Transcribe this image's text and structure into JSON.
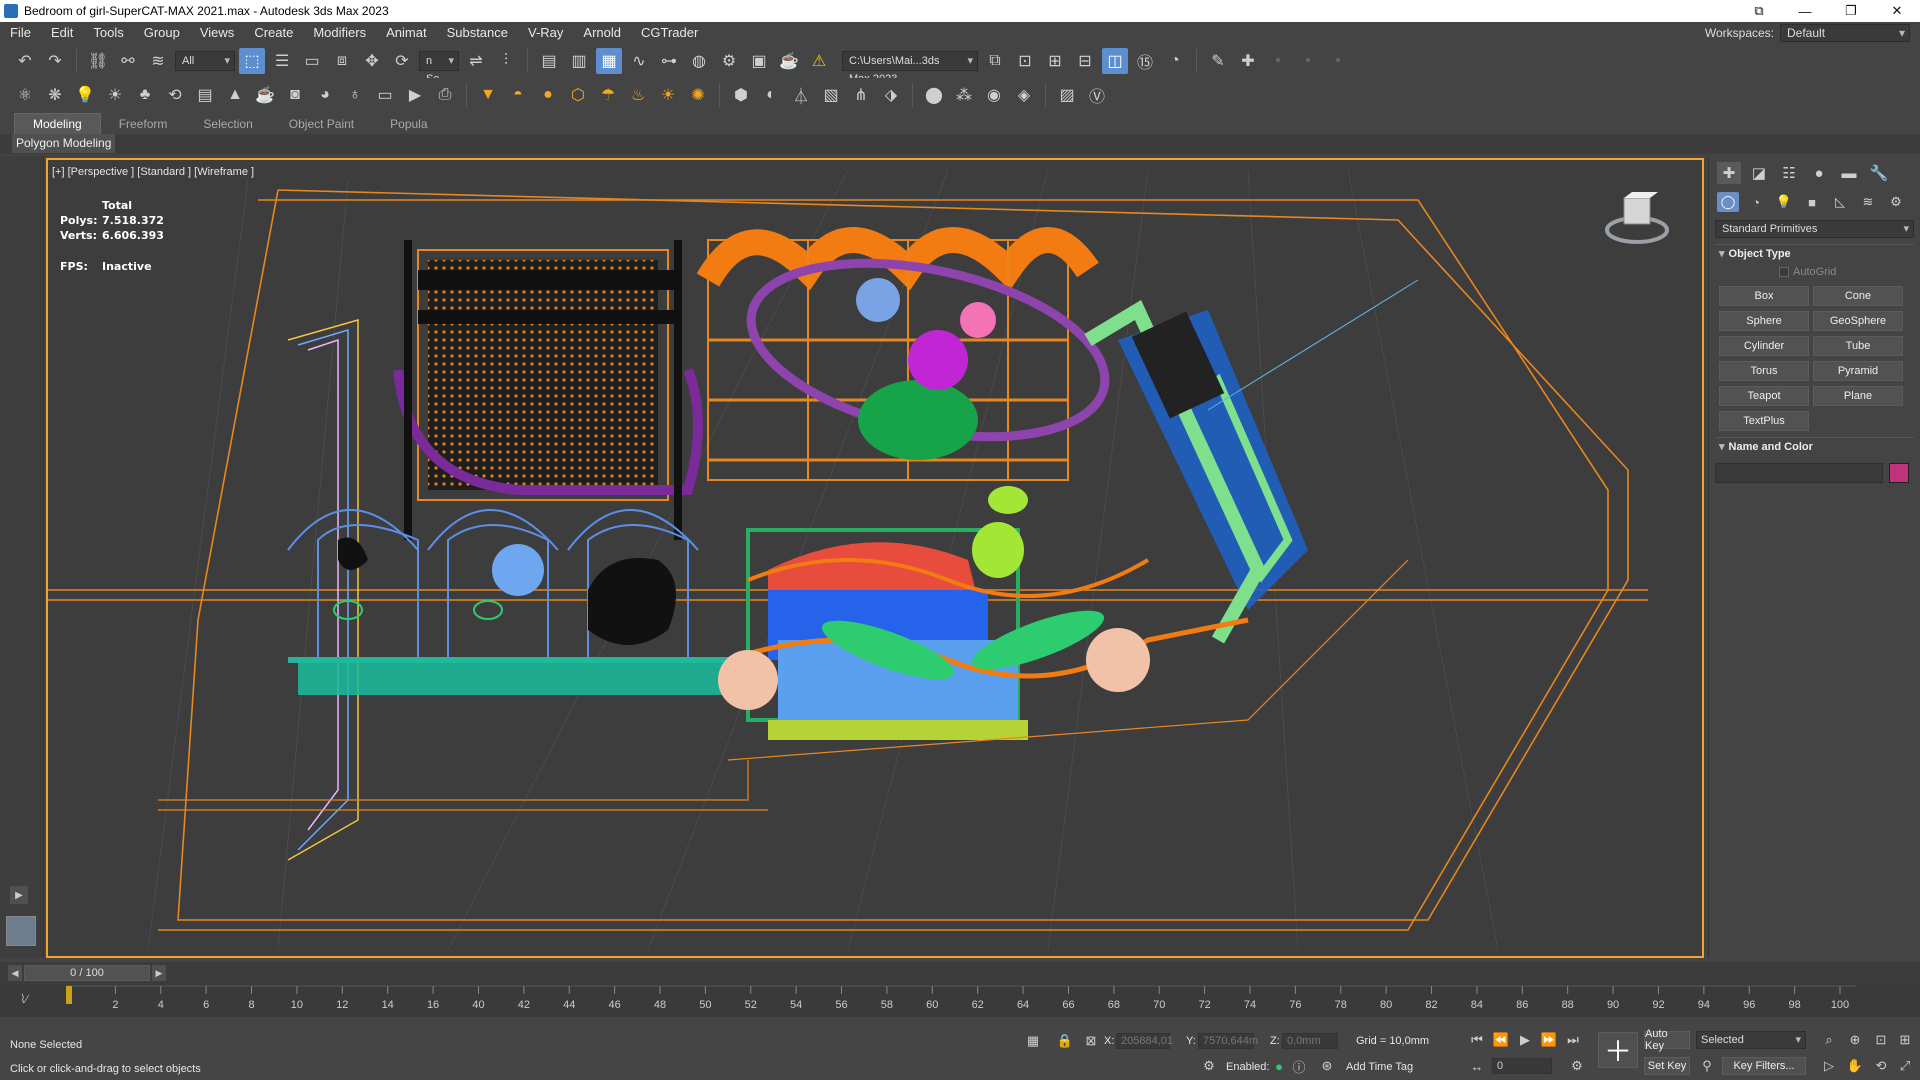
{
  "window": {
    "title": "Bedroom of girl-SuperCAT-MAX 2021.max - Autodesk 3ds Max 2023",
    "controls": [
      "⧉",
      "—",
      "❐",
      "✕"
    ]
  },
  "menu": {
    "items": [
      "File",
      "Edit",
      "Tools",
      "Group",
      "Views",
      "Create",
      "Modifiers",
      "Animat",
      "Substance",
      "V-Ray",
      "Arnold",
      "CGTrader"
    ],
    "workspaces_label": "Workspaces:",
    "workspaces_value": "Default"
  },
  "toolbar1": {
    "selection_filter": "All",
    "ref_coord": "n Se",
    "project_path": "C:\\Users\\Mai...3ds Max 2023"
  },
  "ribbon": {
    "tabs": [
      "Modeling",
      "Freeform",
      "Selection",
      "Object Paint",
      "Popula"
    ],
    "active_tab": "Modeling",
    "sub_label": "Polygon Modeling"
  },
  "viewport": {
    "label": "[+] [Perspective ] [Standard ] [Wireframe ]",
    "stats": {
      "header": "Total",
      "polys_label": "Polys:",
      "polys_value": "7.518.372",
      "verts_label": "Verts:",
      "verts_value": "6.606.393",
      "fps_label": "FPS:",
      "fps_value": "Inactive"
    }
  },
  "command_panel": {
    "category": "Standard Primitives",
    "object_type_title": "Object Type",
    "autogrid": "AutoGrid",
    "primitives": [
      "Box",
      "Cone",
      "Sphere",
      "GeoSphere",
      "Cylinder",
      "Tube",
      "Torus",
      "Pyramid",
      "Teapot",
      "Plane",
      "TextPlus"
    ],
    "name_color_title": "Name and Color",
    "object_color": "#c0337c"
  },
  "timeline": {
    "frame_display": "0 / 100",
    "ticks": [
      "2",
      "4",
      "6",
      "8",
      "10",
      "12",
      "14",
      "16",
      "40",
      "42",
      "44",
      "46",
      "48",
      "50",
      "52",
      "54",
      "56",
      "58",
      "60",
      "62",
      "64",
      "66",
      "68",
      "70",
      "72",
      "74",
      "76",
      "78",
      "80",
      "82",
      "84",
      "86",
      "88",
      "90",
      "92",
      "94",
      "96",
      "98",
      "100"
    ]
  },
  "status": {
    "selection": "None Selected",
    "prompt": "Click or click-and-drag to select objects",
    "x_label": "X:",
    "x_value": "205884,01",
    "y_label": "Y:",
    "y_value": "7570,644m",
    "z_label": "Z:",
    "z_value": "0,0mm",
    "grid": "Grid = 10,0mm",
    "enabled_label": "Enabled:",
    "add_time_tag": "Add Time Tag",
    "auto_key": "Auto Key",
    "set_key": "Set Key",
    "key_mode": "Selected",
    "key_filters": "Key Filters...",
    "frame_field": "0"
  }
}
